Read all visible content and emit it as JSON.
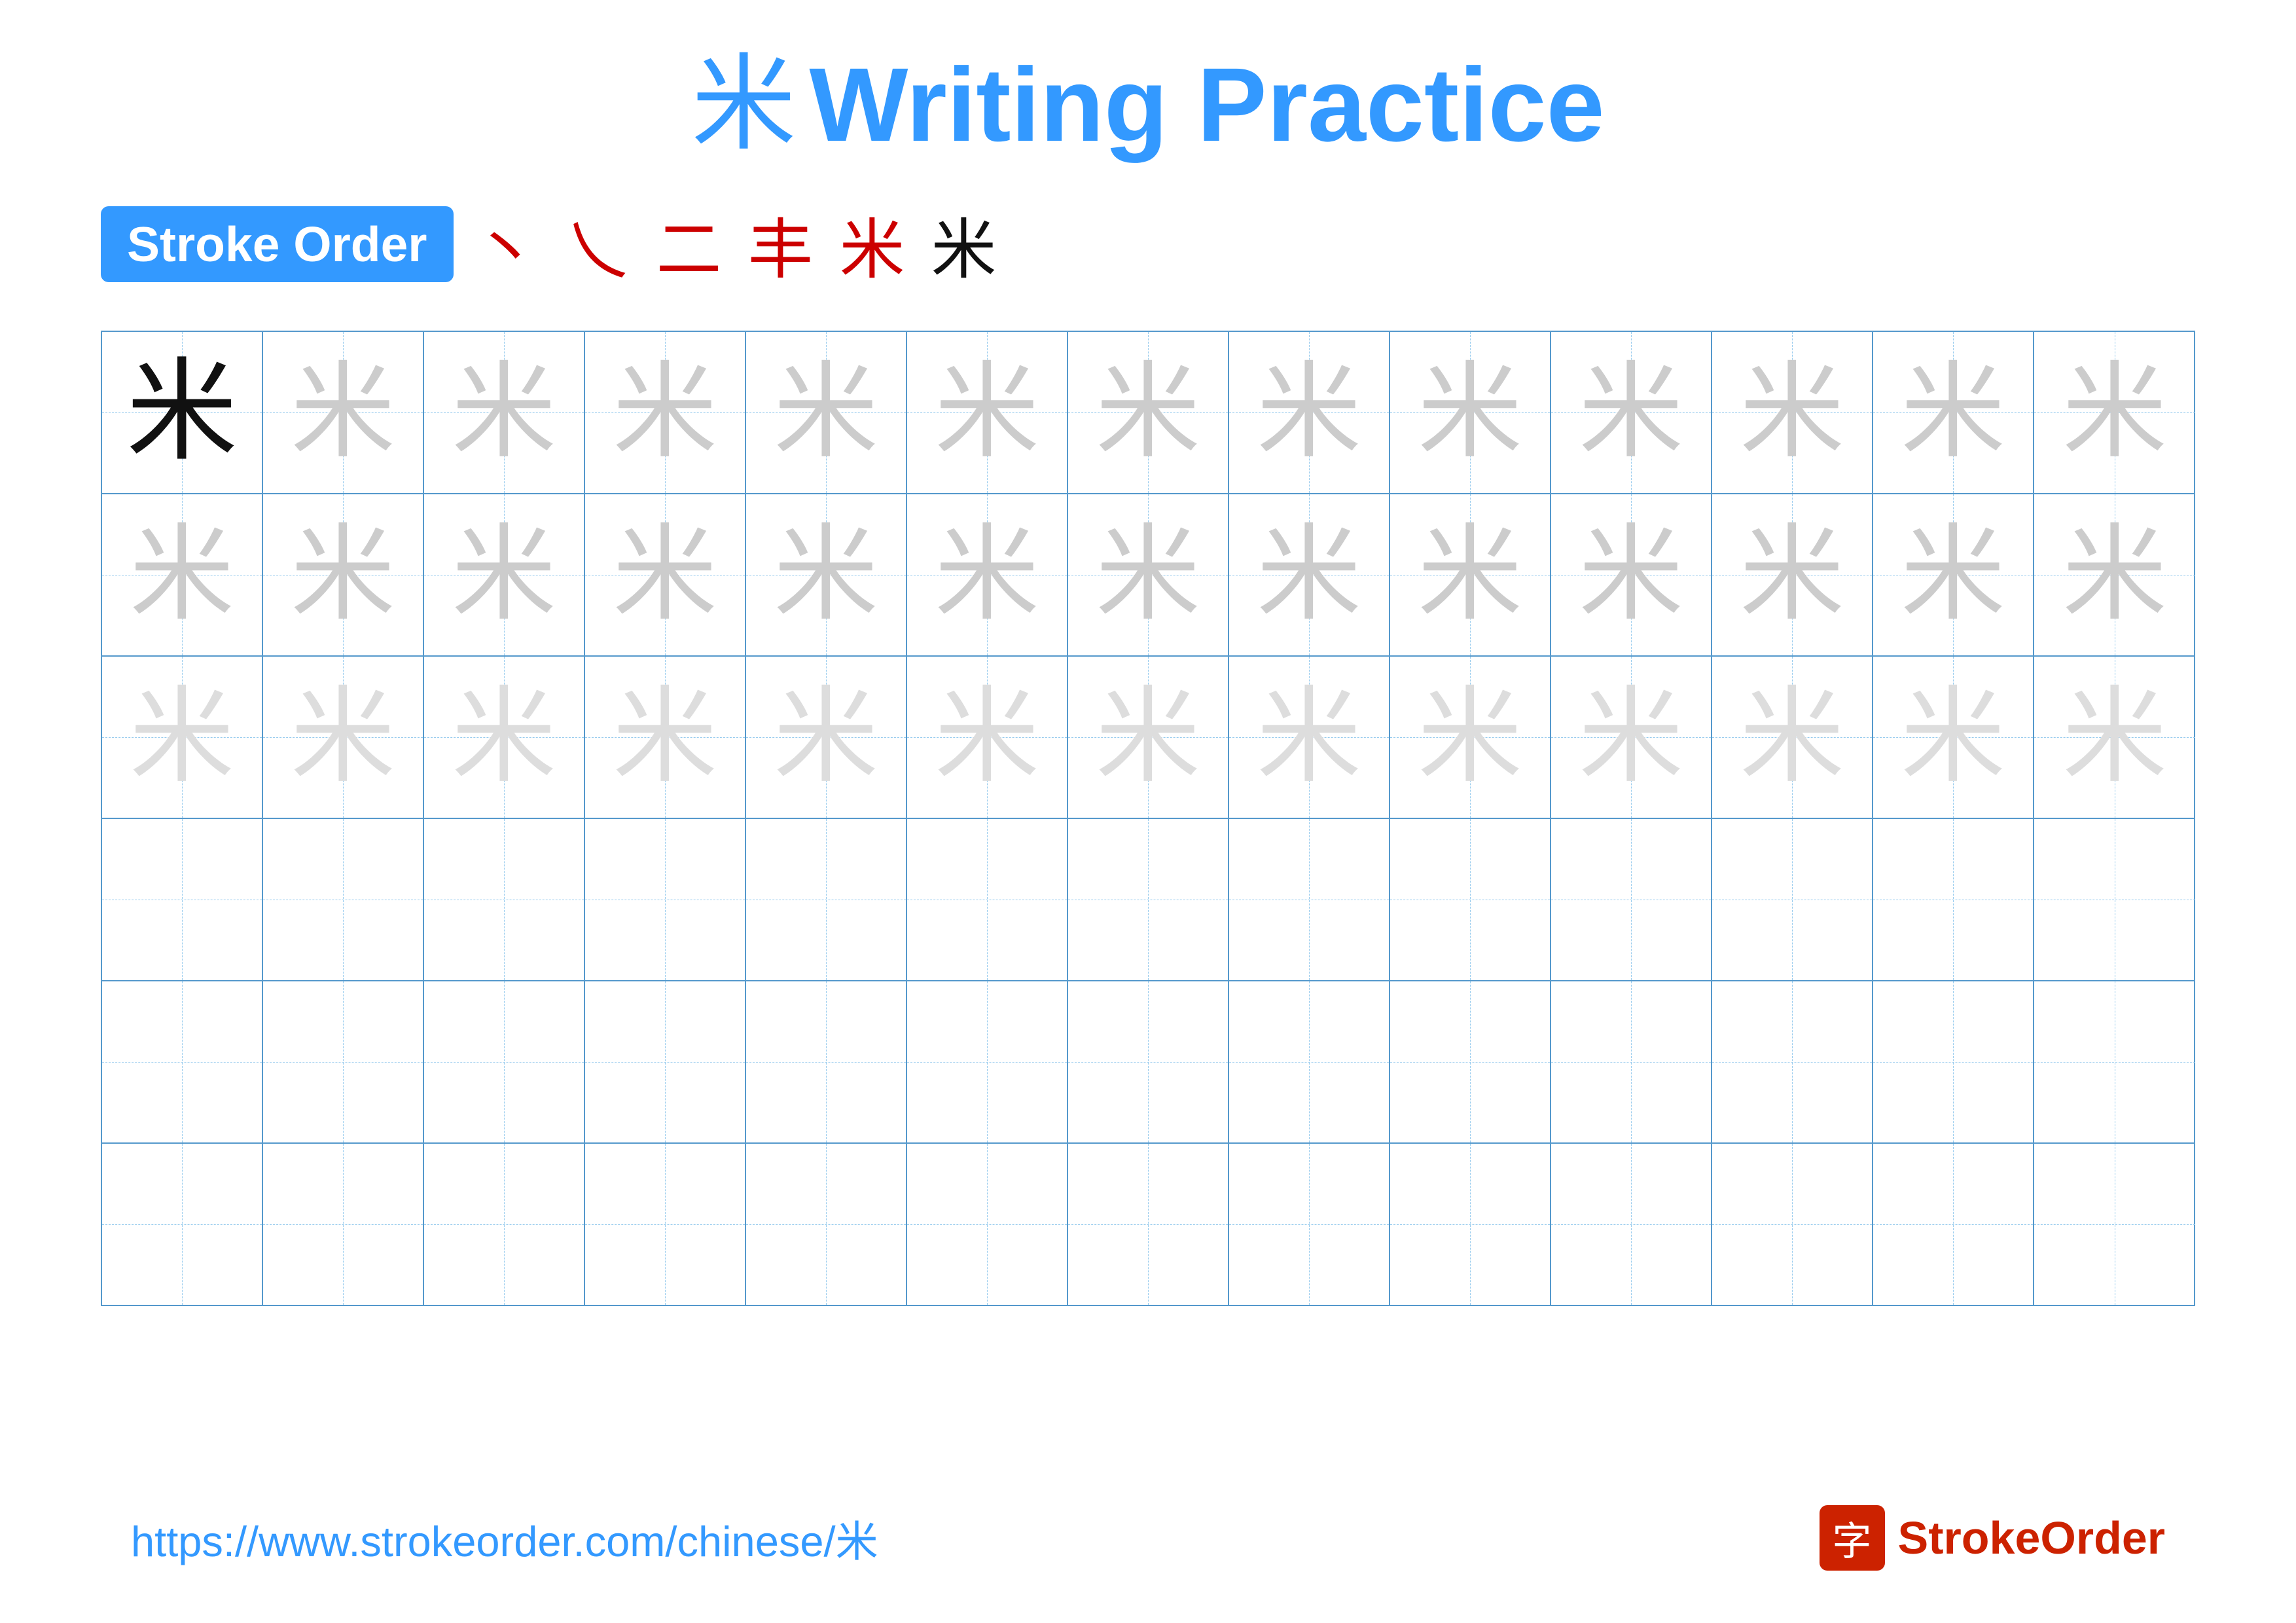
{
  "title": {
    "char": "米",
    "text": "Writing Practice"
  },
  "stroke_order": {
    "badge_label": "Stroke Order",
    "steps": [
      "丶",
      "乀",
      "二",
      "丰",
      "米",
      "米"
    ]
  },
  "grid": {
    "rows": 6,
    "cols": 13,
    "character": "米",
    "ghost_rows": [
      0,
      1,
      2
    ],
    "empty_rows": [
      3,
      4,
      5
    ]
  },
  "footer": {
    "url": "https://www.strokeorder.com/chinese/米",
    "logo_char": "字",
    "logo_text": "StrokeOrder"
  },
  "colors": {
    "blue": "#3399ff",
    "red": "#cc2200",
    "grid_blue": "#5599cc",
    "ghost": "#cccccc",
    "light": "#dddddd",
    "black": "#111111",
    "white": "#ffffff"
  }
}
